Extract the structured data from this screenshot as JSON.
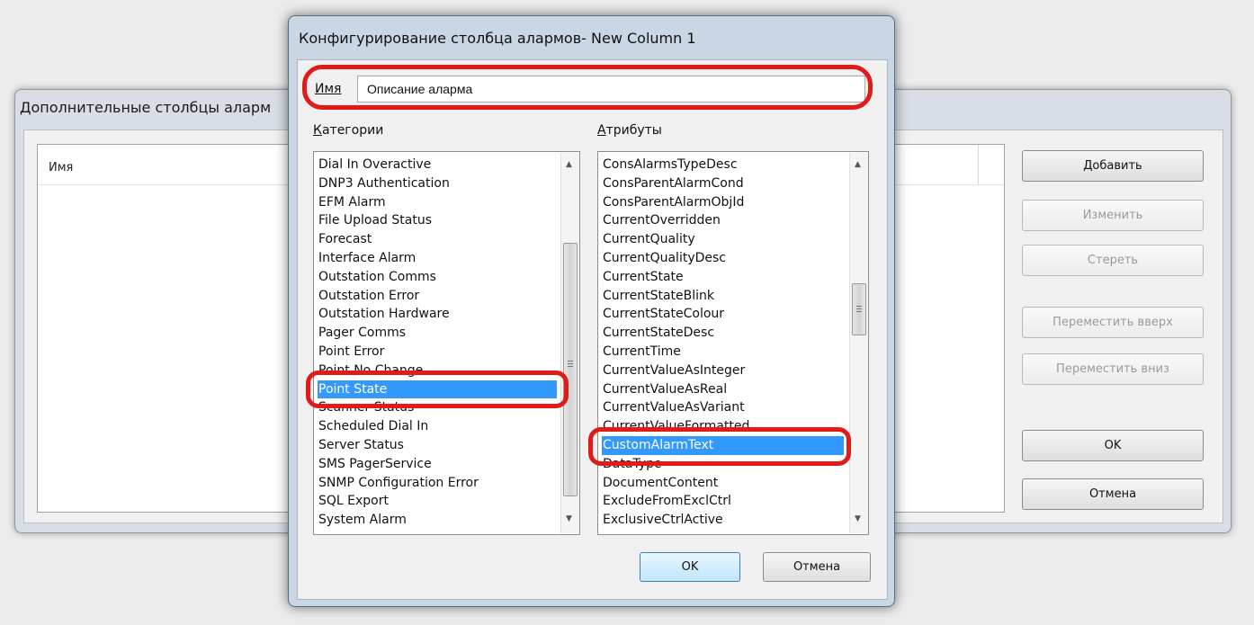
{
  "background_dialog": {
    "title": "Дополнительные столбцы аларм",
    "column_header": "Имя",
    "buttons": {
      "add": "Добавить",
      "edit": "Изменить",
      "delete": "Стереть",
      "move_up": "Переместить вверх",
      "move_down": "Переместить вниз",
      "ok": "OK",
      "cancel": "Отмена"
    }
  },
  "dialog": {
    "title": "Конфигурирование столбца алармов- New Column 1",
    "name_label": "Имя",
    "name_value": "Описание аларма",
    "categories_label": "Категории",
    "attributes_label": "Атрибуты",
    "categories": [
      "Dial In Overactive",
      "DNP3 Authentication",
      "EFM Alarm",
      "File Upload Status",
      "Forecast",
      "Interface Alarm",
      "Outstation Comms",
      "Outstation Error",
      "Outstation Hardware",
      "Pager Comms",
      "Point Error",
      "Point No Change",
      "Point State",
      "Scanner Status",
      "Scheduled Dial In",
      "Server Status",
      "SMS PagerService",
      "SNMP Configuration Error",
      "SQL Export",
      "System Alarm"
    ],
    "selected_category": "Point State",
    "attributes": [
      "ConsAlarmsTypeDesc",
      "ConsParentAlarmCond",
      "ConsParentAlarmObjId",
      "CurrentOverridden",
      "CurrentQuality",
      "CurrentQualityDesc",
      "CurrentState",
      "CurrentStateBlink",
      "CurrentStateColour",
      "CurrentStateDesc",
      "CurrentTime",
      "CurrentValueAsInteger",
      "CurrentValueAsReal",
      "CurrentValueAsVariant",
      "CurrentValueFormatted",
      "CustomAlarmText",
      "DataType",
      "DocumentContent",
      "ExcludeFromExclCtrl",
      "ExclusiveCtrlActive"
    ],
    "selected_attribute": "CustomAlarmText",
    "ok_label": "OK",
    "cancel_label": "Отмена"
  },
  "colors": {
    "highlight": "#e11a1a",
    "selection": "#3399ff"
  }
}
